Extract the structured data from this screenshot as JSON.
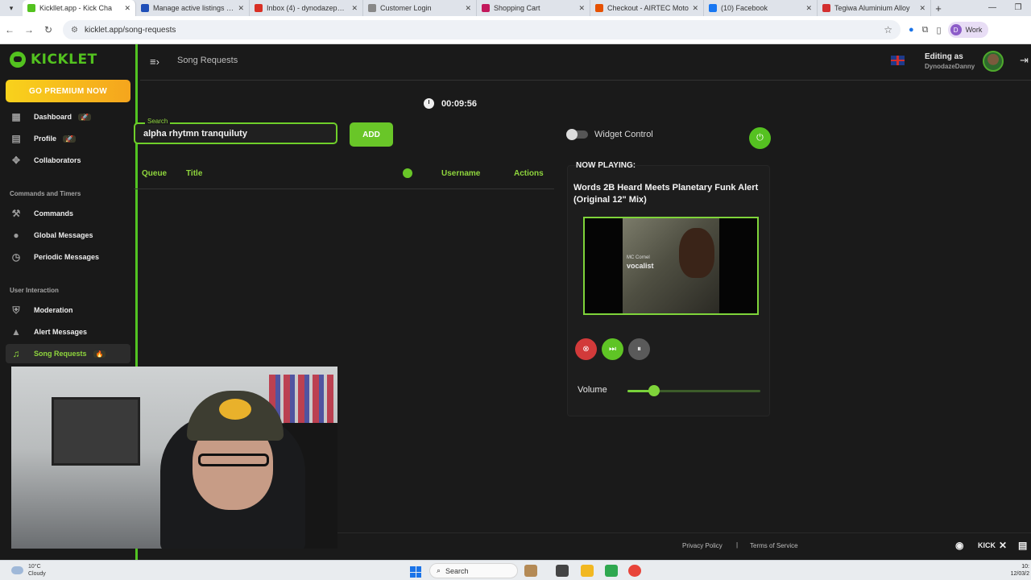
{
  "browser": {
    "tabs": [
      {
        "label": "Kickllet.app - Kick Cha",
        "color": "#53c21f",
        "active": true
      },
      {
        "label": "Manage active listings - e",
        "color": "#1f4fb8",
        "active": false
      },
      {
        "label": "Inbox (4) - dynodazepp@",
        "color": "#d93025",
        "active": false
      },
      {
        "label": "Customer Login",
        "color": "#888888",
        "active": false
      },
      {
        "label": "Shopping Cart",
        "color": "#c2185b",
        "active": false
      },
      {
        "label": "Checkout - AIRTEC Moto",
        "color": "#e65100",
        "active": false
      },
      {
        "label": "(10) Facebook",
        "color": "#1877f2",
        "active": false
      },
      {
        "label": "Tegiwa Aluminium Alloy",
        "color": "#d32f2f",
        "active": false
      }
    ],
    "url": "kicklet.app/song-requests",
    "profile_label": "Work",
    "profile_initial": "D"
  },
  "sidebar": {
    "brand": "KICKLET",
    "premium_label": "GO PREMIUM NOW",
    "items": [
      {
        "label": "Dashboard",
        "icon": "dashboard-icon",
        "glyph": "▦",
        "badge": "🚀"
      },
      {
        "label": "Profile",
        "icon": "profile-icon",
        "glyph": "▤",
        "badge": "🚀"
      },
      {
        "label": "Collaborators",
        "icon": "handshake-icon",
        "glyph": "✥",
        "badge": ""
      }
    ],
    "section_commands": "Commands and Timers",
    "commands_items": [
      {
        "label": "Commands",
        "icon": "wrench-icon",
        "glyph": "⚒"
      },
      {
        "label": "Global Messages",
        "icon": "chat-icon",
        "glyph": "●"
      },
      {
        "label": "Periodic Messages",
        "icon": "clock-icon",
        "glyph": "◷"
      }
    ],
    "section_user": "User Interaction",
    "user_items": [
      {
        "label": "Moderation",
        "icon": "shield-icon",
        "glyph": "⛨"
      },
      {
        "label": "Alert Messages",
        "icon": "warning-icon",
        "glyph": "▲"
      },
      {
        "label": "Song Requests",
        "icon": "music-icon",
        "glyph": "♫",
        "badge": "🔥"
      }
    ]
  },
  "topbar": {
    "page_title": "Song Requests",
    "editing_label": "Editing as",
    "username": "DynodazeDanny"
  },
  "timer": "00:09:56",
  "search": {
    "legend": "Search",
    "value": "alpha rhytmn tranquiluty",
    "add_label": "ADD"
  },
  "table": {
    "headers": {
      "queue": "Queue",
      "title": "Title",
      "username": "Username",
      "actions": "Actions"
    }
  },
  "widget": {
    "label": "Widget Control",
    "now_playing_label": "NOW PLAYING:",
    "track_title": "Words 2B Heard Meets Planetary Funk Alert (Original 12\" Mix)",
    "art_line1": "MC Cornel",
    "art_line2": "vocalist",
    "volume_label": "Volume",
    "volume_fraction": 0.2
  },
  "footer": {
    "privacy": "Privacy Policy",
    "separator": "|",
    "terms": "Terms of Service",
    "social": [
      "discord-icon",
      "kick-icon",
      "x-icon",
      "doc-icon"
    ],
    "kick_label": "KICK"
  },
  "taskbar": {
    "temp": "10°C",
    "weather": "Cloudy",
    "search_label": "Search",
    "time": "10:",
    "date": "12/03/2"
  }
}
